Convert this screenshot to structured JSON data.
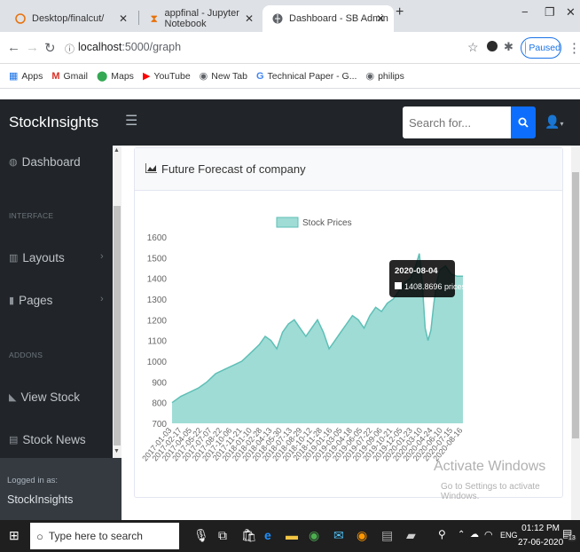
{
  "browser": {
    "tabs": [
      {
        "label": "Desktop/finalcut/",
        "icon": "spinner-icon"
      },
      {
        "label": "appfinal - Jupyter Notebook",
        "icon": "hourglass-icon"
      },
      {
        "label": "Dashboard - SB Admin",
        "icon": "globe-icon"
      }
    ],
    "new_tab_symbol": "+",
    "url_host": "localhost",
    "url_rest": ":5000/graph",
    "profile_status": "Paused",
    "bookmarks": [
      {
        "label": "Apps",
        "icon": "apps-grid-icon"
      },
      {
        "label": "Gmail",
        "icon": "gmail-icon"
      },
      {
        "label": "Maps",
        "icon": "maps-pin-icon"
      },
      {
        "label": "YouTube",
        "icon": "youtube-icon"
      },
      {
        "label": "New Tab",
        "icon": "globe-icon"
      },
      {
        "label": "Technical Paper - G...",
        "icon": "google-icon"
      },
      {
        "label": "philips",
        "icon": "globe-icon"
      }
    ]
  },
  "app": {
    "brand": "StockInsights",
    "search_placeholder": "Search for...",
    "sidebar": {
      "dashboard": "Dashboard",
      "heading_interface": "INTERFACE",
      "layouts": "Layouts",
      "pages": "Pages",
      "heading_addons": "ADDONS",
      "view_stock": "View Stock",
      "stock_news": "Stock News",
      "logged_in_label": "Logged in as:",
      "logged_in_user": "StockInsights"
    },
    "card_title": "Future Forecast of company"
  },
  "chart_data": {
    "type": "area",
    "legend": [
      "Stock Prices"
    ],
    "series_color": "#9fdcd6",
    "series_line_color": "#5ebfb6",
    "ylim": [
      700,
      1600
    ],
    "yticks": [
      700,
      800,
      900,
      1000,
      1100,
      1200,
      1300,
      1400,
      1500,
      1600
    ],
    "xticks": [
      "2017-01-03",
      "2017-02-17",
      "2017-04-05",
      "2017-05-22",
      "2017-07-07",
      "2017-08-22",
      "2017-10-06",
      "2017-11-21",
      "2018-01-10",
      "2018-02-28",
      "2018-04-13",
      "2018-05-30",
      "2018-07-13",
      "2018-08-29",
      "2018-10-12",
      "2018-11-28",
      "2019-01-16",
      "2019-03-05",
      "2019-04-18",
      "2019-06-05",
      "2019-07-22",
      "2019-09-06",
      "2019-10-21",
      "2019-12-05",
      "2020-01-23",
      "2020-03-10",
      "2020-04-24",
      "2020-06-10",
      "2020-07-15",
      "2020-08-16"
    ],
    "points": [
      [
        0,
        800
      ],
      [
        0.03,
        830
      ],
      [
        0.06,
        850
      ],
      [
        0.09,
        870
      ],
      [
        0.12,
        900
      ],
      [
        0.15,
        940
      ],
      [
        0.18,
        960
      ],
      [
        0.21,
        980
      ],
      [
        0.24,
        1000
      ],
      [
        0.27,
        1040
      ],
      [
        0.3,
        1080
      ],
      [
        0.32,
        1120
      ],
      [
        0.34,
        1100
      ],
      [
        0.36,
        1060
      ],
      [
        0.38,
        1140
      ],
      [
        0.4,
        1180
      ],
      [
        0.42,
        1200
      ],
      [
        0.44,
        1160
      ],
      [
        0.46,
        1120
      ],
      [
        0.48,
        1160
      ],
      [
        0.5,
        1200
      ],
      [
        0.52,
        1140
      ],
      [
        0.54,
        1060
      ],
      [
        0.56,
        1100
      ],
      [
        0.58,
        1140
      ],
      [
        0.6,
        1180
      ],
      [
        0.62,
        1220
      ],
      [
        0.64,
        1200
      ],
      [
        0.66,
        1160
      ],
      [
        0.68,
        1220
      ],
      [
        0.7,
        1260
      ],
      [
        0.72,
        1240
      ],
      [
        0.74,
        1280
      ],
      [
        0.76,
        1300
      ],
      [
        0.78,
        1340
      ],
      [
        0.8,
        1380
      ],
      [
        0.82,
        1400
      ],
      [
        0.84,
        1470
      ],
      [
        0.85,
        1520
      ],
      [
        0.86,
        1380
      ],
      [
        0.87,
        1160
      ],
      [
        0.88,
        1100
      ],
      [
        0.89,
        1150
      ],
      [
        0.9,
        1280
      ],
      [
        0.91,
        1380
      ],
      [
        0.92,
        1440
      ],
      [
        0.94,
        1460
      ],
      [
        0.96,
        1420
      ],
      [
        0.98,
        1410
      ],
      [
        1,
        1410
      ]
    ],
    "tooltip": {
      "date": "2020-08-04",
      "value": "1408.8696 prices"
    }
  },
  "os": {
    "watermark_title": "Activate Windows",
    "watermark_sub": "Go to Settings to activate Windows.",
    "taskbar_search": "Type here to search",
    "language": "ENG",
    "time": "01:12 PM",
    "date": "27-06-2020",
    "notification_count": "13"
  }
}
